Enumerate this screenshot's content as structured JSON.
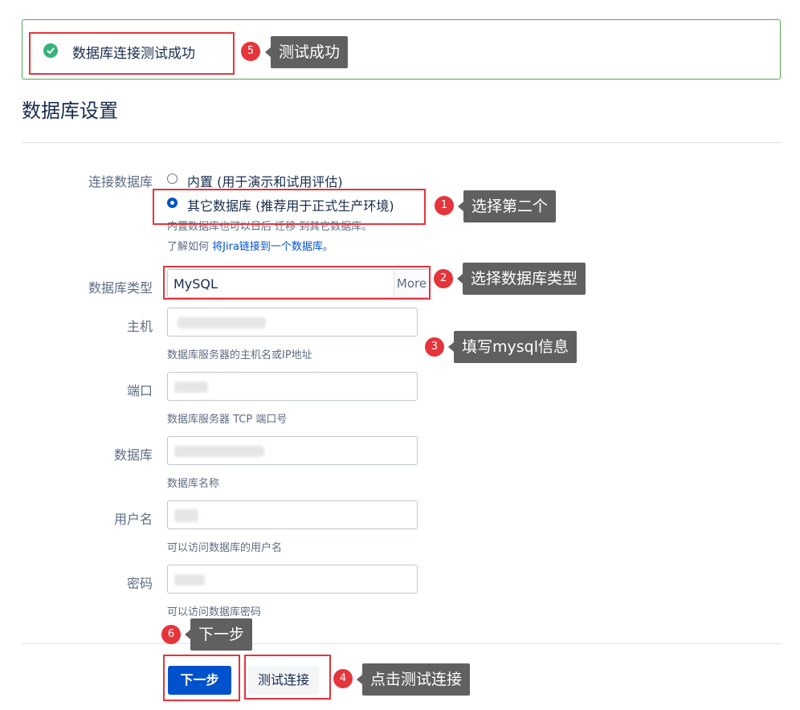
{
  "banner": {
    "message": "数据库连接测试成功"
  },
  "heading": "数据库设置",
  "form": {
    "connection": {
      "label": "连接数据库",
      "options": [
        {
          "text": "内置 (用于演示和试用评估)",
          "checked": false
        },
        {
          "text": "其它数据库 (推荐用于正式生产环境)",
          "checked": true
        }
      ],
      "help_line1": "内置数据库也可以日后 迁移 到其它数据库。",
      "help_line2_prefix": "了解如何",
      "help_line2_link": "将Jira链接到一个数据库。"
    },
    "db_type": {
      "label": "数据库类型",
      "value": "MySQL",
      "more": "More"
    },
    "host": {
      "label": "主机",
      "help": "数据库服务器的主机名或IP地址"
    },
    "port": {
      "label": "端口",
      "help": "数据库服务器 TCP 端口号"
    },
    "database": {
      "label": "数据库",
      "help": "数据库名称"
    },
    "username": {
      "label": "用户名",
      "help": "可以访问数据库的用户名"
    },
    "password": {
      "label": "密码",
      "help": "可以访问数据库密码"
    }
  },
  "buttons": {
    "next": "下一步",
    "test": "测试连接"
  },
  "annotations": [
    {
      "num": "1",
      "text": "选择第二个"
    },
    {
      "num": "2",
      "text": "选择数据库类型"
    },
    {
      "num": "3",
      "text": "填写mysql信息"
    },
    {
      "num": "4",
      "text": "点击测试连接"
    },
    {
      "num": "5",
      "text": "测试成功"
    },
    {
      "num": "6",
      "text": "下一步"
    }
  ],
  "colors": {
    "primary": "#0052cc",
    "success": "#36b37e",
    "annotation_red": "#e5343a",
    "tooltip": "#606060"
  }
}
